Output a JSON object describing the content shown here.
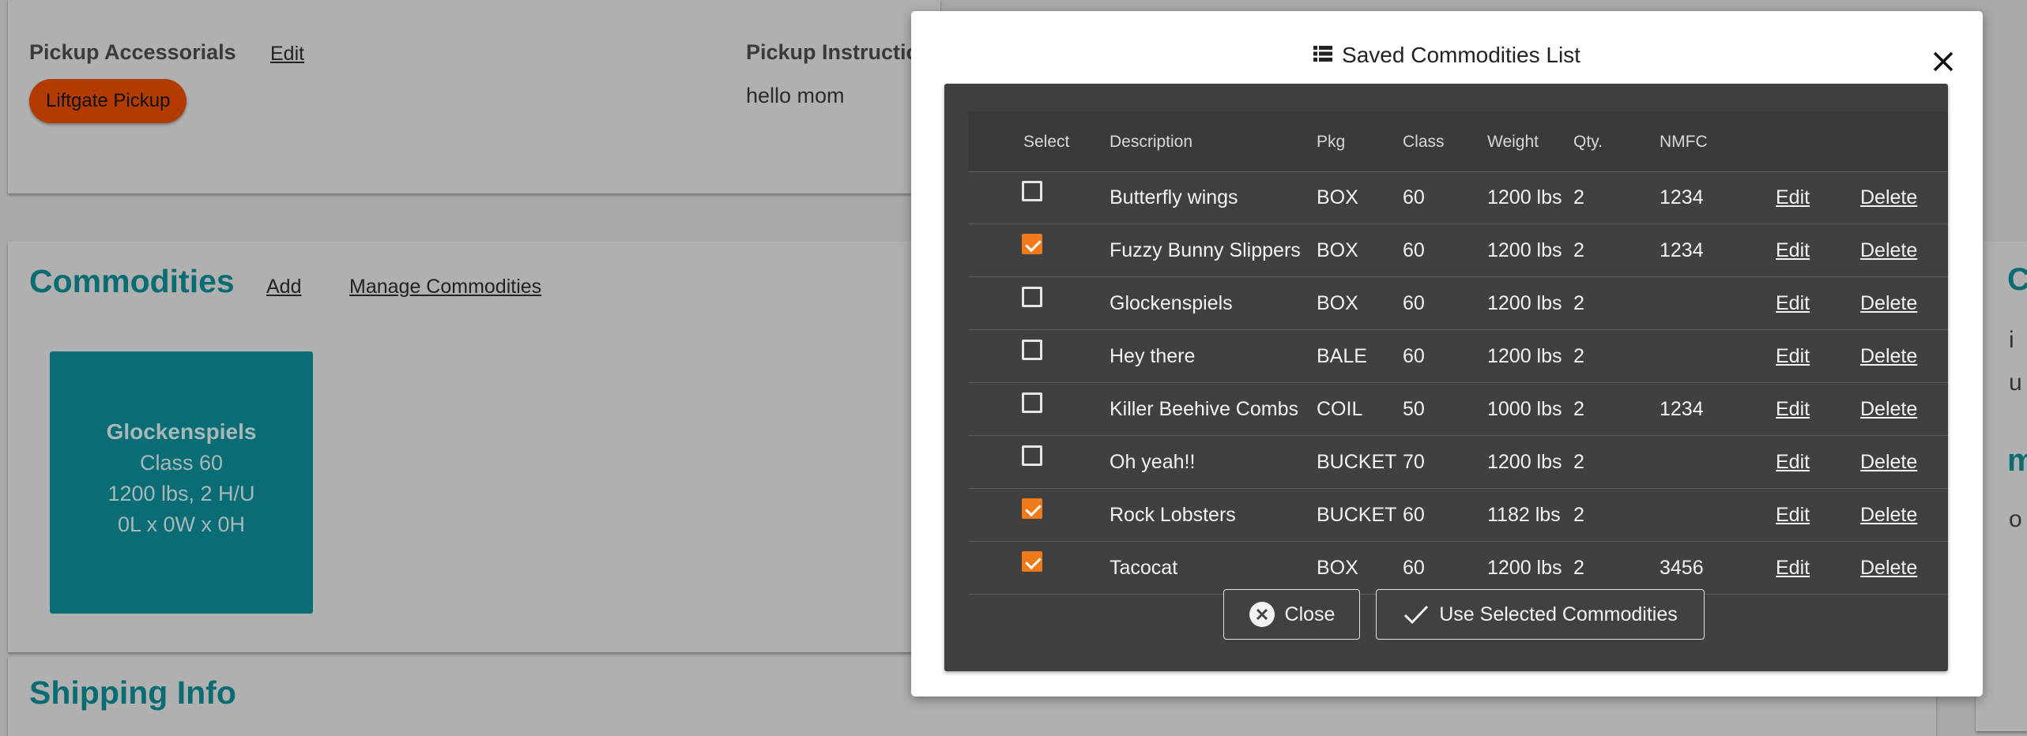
{
  "pickup": {
    "accessorials_label": "Pickup Accessorials",
    "edit_label": "Edit",
    "accessorial_pill": "Liftgate Pickup",
    "instructions_label": "Pickup Instructio",
    "instructions_text": "hello mom"
  },
  "commodities": {
    "title": "Commodities",
    "add_label": "Add",
    "manage_label": "Manage Commodities",
    "tile": {
      "name": "Glockenspiels",
      "class_line": "Class 60",
      "weight_line": "1200 lbs, 2 H/U",
      "dims_line": "0L x 0W x 0H"
    }
  },
  "shipping": {
    "title": "Shipping Info"
  },
  "right_edge": {
    "glyph1": "C",
    "glyph2": "i",
    "glyph3": "u",
    "glyph4": "m",
    "glyph5": "o"
  },
  "modal": {
    "title": "Saved Commodities List",
    "icon": "list-icon",
    "columns": [
      "Select",
      "Description",
      "Pkg",
      "Class",
      "Weight",
      "Qty.",
      "NMFC"
    ],
    "rows": [
      {
        "selected": false,
        "description": "Butterfly wings",
        "pkg": "BOX",
        "class": "60",
        "weight": "1200 lbs",
        "qty": "2",
        "nmfc": "1234",
        "edit": "Edit",
        "delete": "Delete"
      },
      {
        "selected": true,
        "description": "Fuzzy Bunny Slippers",
        "pkg": "BOX",
        "class": "60",
        "weight": "1200 lbs",
        "qty": "2",
        "nmfc": "1234",
        "edit": "Edit",
        "delete": "Delete"
      },
      {
        "selected": false,
        "description": "Glockenspiels",
        "pkg": "BOX",
        "class": "60",
        "weight": "1200 lbs",
        "qty": "2",
        "nmfc": "",
        "edit": "Edit",
        "delete": "Delete"
      },
      {
        "selected": false,
        "description": "Hey there",
        "pkg": "BALE",
        "class": "60",
        "weight": "1200 lbs",
        "qty": "2",
        "nmfc": "",
        "edit": "Edit",
        "delete": "Delete"
      },
      {
        "selected": false,
        "description": "Killer Beehive Combs",
        "pkg": "COIL",
        "class": "50",
        "weight": "1000 lbs",
        "qty": "2",
        "nmfc": "1234",
        "edit": "Edit",
        "delete": "Delete"
      },
      {
        "selected": false,
        "description": "Oh yeah!!",
        "pkg": "BUCKET",
        "class": "70",
        "weight": "1200 lbs",
        "qty": "2",
        "nmfc": "",
        "edit": "Edit",
        "delete": "Delete"
      },
      {
        "selected": true,
        "description": "Rock Lobsters",
        "pkg": "BUCKET",
        "class": "60",
        "weight": "1182 lbs",
        "qty": "2",
        "nmfc": "",
        "edit": "Edit",
        "delete": "Delete"
      },
      {
        "selected": true,
        "description": "Tacocat",
        "pkg": "BOX",
        "class": "60",
        "weight": "1200 lbs",
        "qty": "2",
        "nmfc": "3456",
        "edit": "Edit",
        "delete": "Delete"
      }
    ],
    "close_button": "Close",
    "use_button": "Use Selected Commodities"
  },
  "colors": {
    "accent_orange": "#f07a1a",
    "pill_orange": "#b23c00",
    "teal": "#0a6c73",
    "panel_dark": "#404040"
  }
}
